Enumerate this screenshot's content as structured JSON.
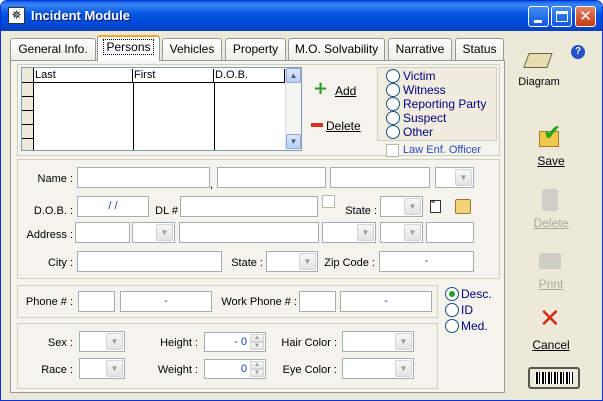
{
  "window": {
    "title": "Incident Module",
    "app_icon": "running-man-icon",
    "icon_glyph": "✵"
  },
  "tabs": [
    {
      "label": "General Info."
    },
    {
      "label": "Persons",
      "active": true
    },
    {
      "label": "Vehicles"
    },
    {
      "label": "Property"
    },
    {
      "label": "M.O. Solvability"
    },
    {
      "label": "Narrative"
    },
    {
      "label": "Status"
    }
  ],
  "persons_grid": {
    "columns": [
      "Last",
      "First",
      "D.O.B."
    ],
    "rows": []
  },
  "actions": {
    "add": "Add",
    "delete": "Delete"
  },
  "role": {
    "options": [
      "Victim",
      "Witness",
      "Reporting Party",
      "Suspect",
      "Other"
    ],
    "law_enf_officer": "Law Enf. Officer"
  },
  "form": {
    "name_label": "Name :",
    "name_sep": ",",
    "dob_label": "D.O.B. :",
    "dob_value": " / /",
    "dl_label": "DL #",
    "state_label": "State :",
    "address_label": "Address :",
    "city_label": "City :",
    "state2_label": "State :",
    "zip_label": "Zip Code :",
    "zip_value": "-",
    "phone_label": "Phone # :",
    "phone_value": "-",
    "work_phone_label": "Work Phone # :",
    "work_phone_value": "-",
    "desc_options": [
      "Desc.",
      "ID",
      "Med."
    ],
    "desc_selected": "Desc.",
    "sex_label": "Sex :",
    "race_label": "Race :",
    "height_label": "Height :",
    "height_value": "- 0",
    "weight_label": "Weight :",
    "weight_value": "0",
    "hair_label": "Hair Color :",
    "eye_label": "Eye Color :"
  },
  "sidebar": {
    "help": "?",
    "diagram": "Diagram",
    "save": "Save",
    "delete": "Delete",
    "print": "Print",
    "cancel": "Cancel"
  },
  "colors": {
    "titlebar": "#0053e1",
    "add_green": "#2d9b22",
    "delete_red": "#d4331f",
    "radio_label": "#000080"
  }
}
